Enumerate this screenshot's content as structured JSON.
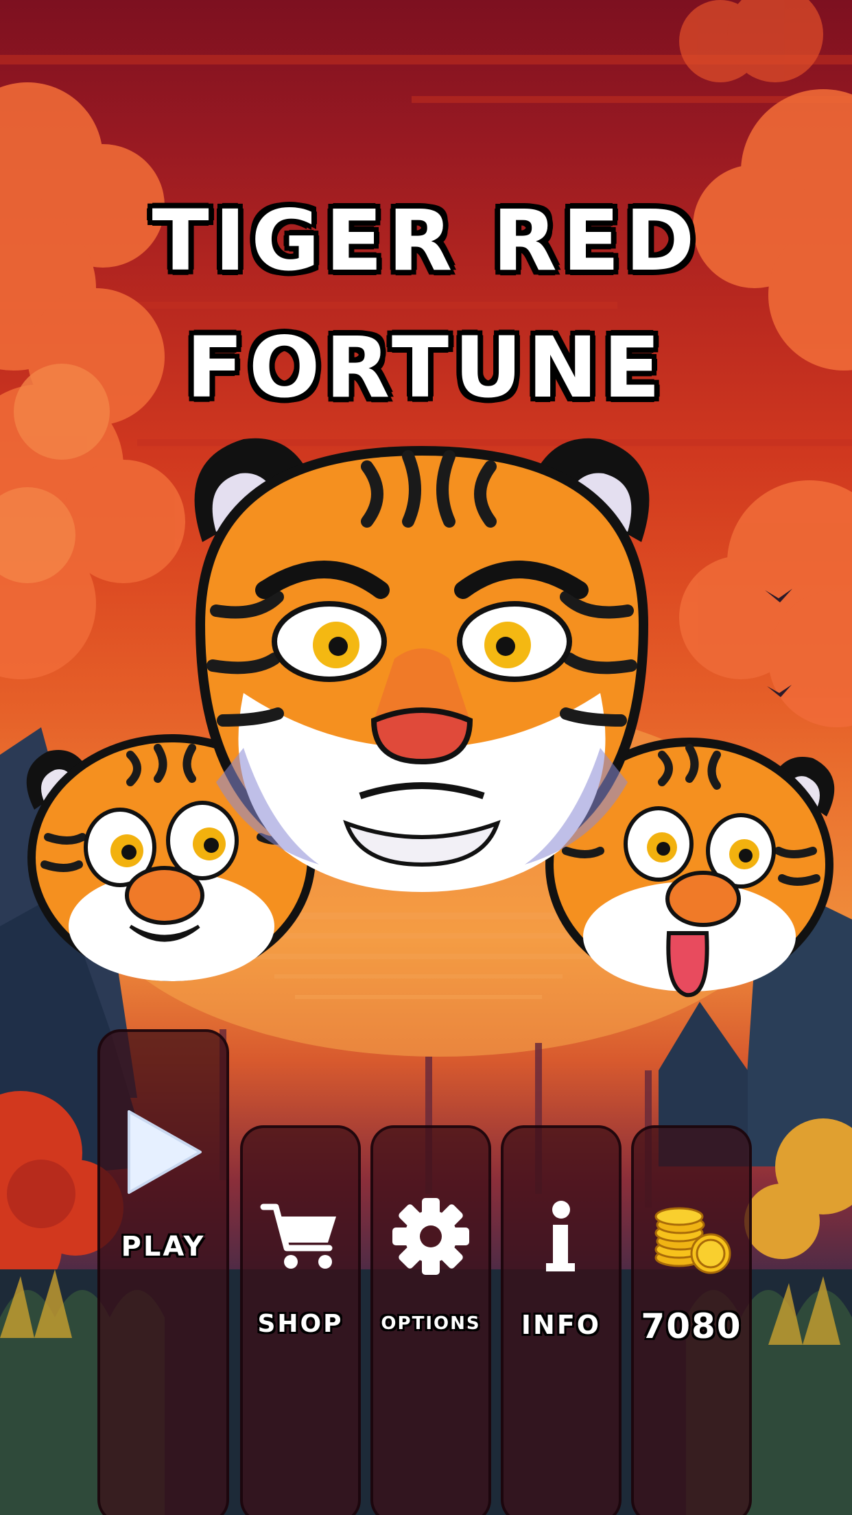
{
  "game": {
    "title_line1": "TIGER RED",
    "title_line2": "FORTUNE"
  },
  "menu": {
    "play_label": "PLAY",
    "shop_label": "SHOP",
    "options_label": "OPTIONS",
    "info_label": "INFO",
    "coins_value": "7080"
  },
  "icons": {
    "play": "play-icon",
    "shop": "cart-icon",
    "options": "gear-icon",
    "info": "info-icon",
    "coins": "coins-icon"
  },
  "colors": {
    "sky_top": "#7d1020",
    "sky_glow": "#f08f3c",
    "button_fill": "#3a0e16",
    "tiger_orange": "#f5901f",
    "coin_gold": "#f7c21c"
  }
}
